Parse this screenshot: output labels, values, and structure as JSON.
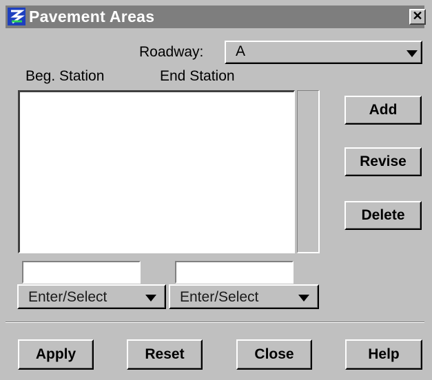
{
  "window": {
    "title": "Pavement Areas",
    "close_glyph": "✕",
    "app_icon": "app-logo-icon"
  },
  "roadway": {
    "label": "Roadway:",
    "value": "A",
    "icon": "chevron-down-icon"
  },
  "columns": {
    "beg": "Beg. Station",
    "end": "End Station"
  },
  "list": {
    "items": []
  },
  "side_buttons": {
    "add": "Add",
    "revise": "Revise",
    "delete": "Delete"
  },
  "beg_input": {
    "value": ""
  },
  "end_input": {
    "value": ""
  },
  "beg_mode": {
    "value": "Enter/Select"
  },
  "end_mode": {
    "value": "Enter/Select"
  },
  "footer": {
    "apply": "Apply",
    "reset": "Reset",
    "close": "Close",
    "help": "Help"
  }
}
